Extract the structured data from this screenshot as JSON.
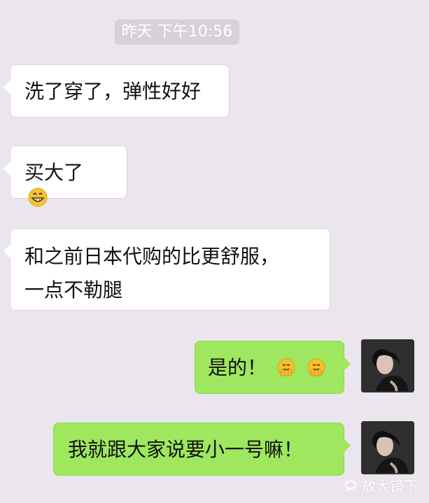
{
  "chat": {
    "timestamp": "昨天 下午10:56",
    "messages": [
      {
        "direction": "incoming",
        "text": "洗了穿了，弹性好好"
      },
      {
        "direction": "incoming",
        "text": "买大了",
        "emoji": "grinning-face"
      },
      {
        "direction": "incoming",
        "lines": [
          "和之前日本代购的比更舒服，",
          "一点不勒腿"
        ]
      },
      {
        "direction": "outgoing",
        "text": "是的！",
        "emojis": [
          "facepalm-face",
          "facepalm-face"
        ]
      },
      {
        "direction": "outgoing",
        "text": "我就跟大家说要小一号嘛！"
      }
    ]
  },
  "watermark": {
    "text": "放大镜下"
  },
  "colors": {
    "background": "#ebe6ed",
    "incoming_bubble": "#ffffff",
    "outgoing_bubble": "#9ee75f",
    "timestamp_pill": "#d6d1da"
  }
}
